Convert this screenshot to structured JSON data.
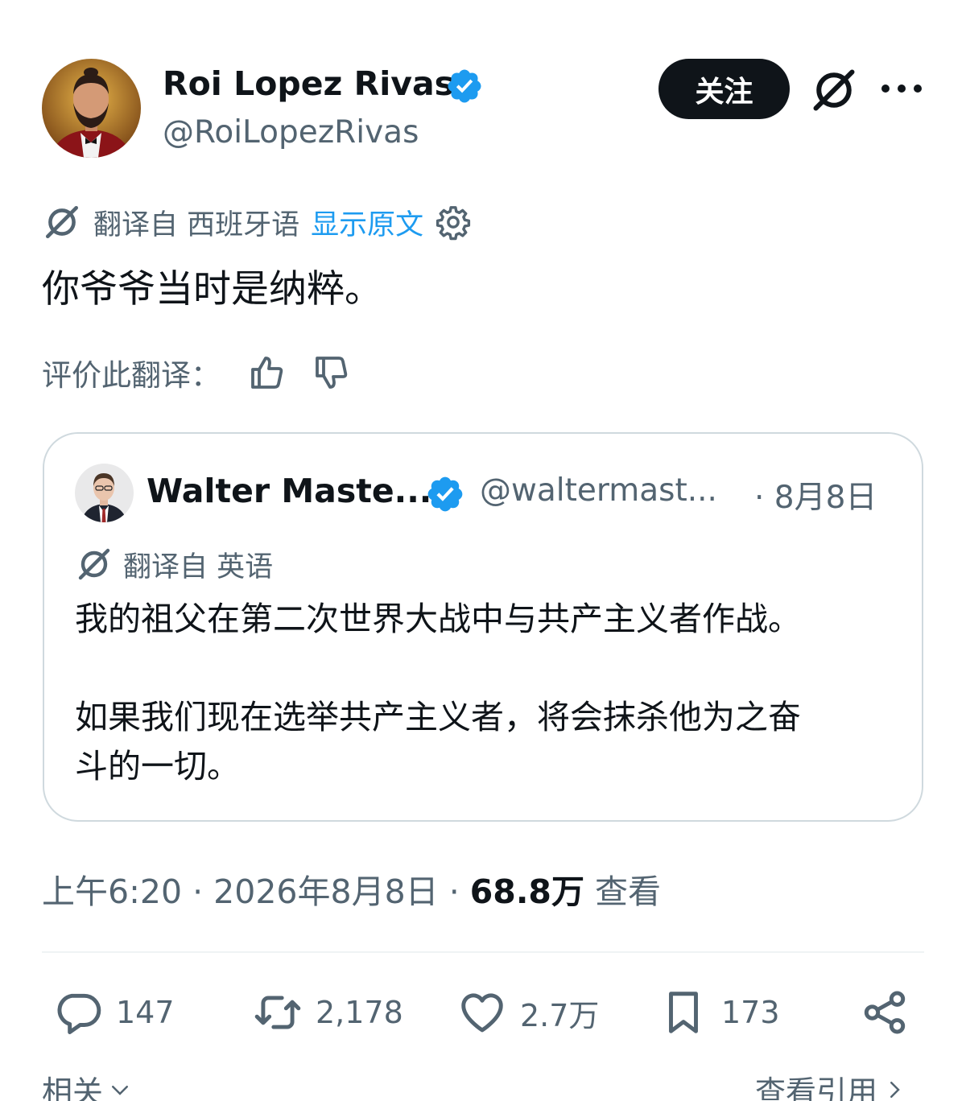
{
  "tweet": {
    "author_name": "Roi Lopez Rivas",
    "author_handle": "@RoiLopezRivas",
    "follow_label": "关注",
    "translation_label": "翻译自 西班牙语",
    "show_original_label": "显示原文",
    "text": "你爷爷当时是纳粹。",
    "rate_label": "评价此翻译："
  },
  "quote": {
    "author_name": "Walter Maste...",
    "author_handle": "@waltermast...",
    "date": "· 8月8日",
    "translation_label": "翻译自 英语",
    "paragraphs": [
      "我的祖父在第二次世界大战中与共产主义者作战。",
      "如果我们现在选举共产主义者，将会抹杀他为之奋",
      "斗的一切。"
    ]
  },
  "meta": {
    "time": "上午6:20 · 2026年8月8日 · ",
    "views_count": "68.8万",
    "views_label": " 查看"
  },
  "actions": {
    "replies": "147",
    "retweets": "2,178",
    "likes": "2.7万",
    "bookmarks": "173"
  },
  "footer": {
    "related_label": "相关",
    "view_quotes_label": "查看引用"
  },
  "icons": {
    "verified": "verified-badge-icon",
    "grok": "grok-icon",
    "more": "more-icon",
    "translate": "translate-icon",
    "settings": "gear-icon",
    "thumbs_up": "thumbs-up-icon",
    "thumbs_down": "thumbs-down-icon",
    "reply": "reply-icon",
    "retweet": "retweet-icon",
    "like": "heart-icon",
    "bookmark": "bookmark-icon",
    "share": "share-icon"
  },
  "colors": {
    "accent": "#1d9bf0",
    "text_primary": "#0f1419",
    "text_secondary": "#536471",
    "border": "#cfd9de"
  }
}
